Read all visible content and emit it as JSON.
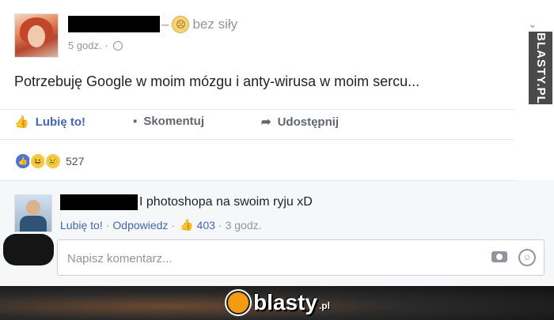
{
  "post": {
    "feeling": "bez siły",
    "time": "5 godz.",
    "text": "Potrzebuję Google w moim mózgu i anty-wirusa w moim sercu..."
  },
  "actions": {
    "like": "Lubię to!",
    "comment": "Skomentuj",
    "share": "Udostępnij"
  },
  "reactions": {
    "count": "527"
  },
  "comment": {
    "text": "I photoshopa na swoim ryju xD",
    "like": "Lubię to!",
    "reply": "Odpowiedz",
    "likes": "403",
    "time": "3 godz."
  },
  "composer": {
    "placeholder": "Napisz komentarz..."
  },
  "watermark": "BLASTY.PL",
  "footer": {
    "logo": "blasty",
    "logo_suffix": ".pl"
  },
  "colors": {
    "link": "#4267b2",
    "muted": "#90949c",
    "bg": "#e9ebee"
  }
}
